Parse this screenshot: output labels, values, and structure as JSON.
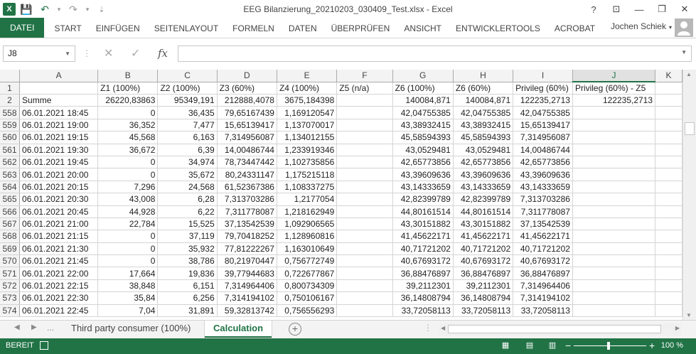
{
  "window": {
    "title": "EEG Bilanzierung_20210203_030409_Test.xlsx - Excel",
    "help": "?",
    "ribbon_display": "⊡",
    "minimize": "—",
    "restore": "❐",
    "close": "✕"
  },
  "qat": {
    "logo": "X",
    "save": "💾",
    "undo": "↶",
    "undo_caret": "▾",
    "redo": "↷",
    "redo_caret": "▾",
    "customize": "⇣"
  },
  "ribbon": {
    "tabs": [
      "DATEI",
      "START",
      "EINFÜGEN",
      "SEITENLAYOUT",
      "FORMELN",
      "DATEN",
      "ÜBERPRÜFEN",
      "ANSICHT",
      "ENTWICKLERTOOLS",
      "ACROBAT"
    ],
    "user": "Jochen Schiek"
  },
  "formula_bar": {
    "name_box": "J8",
    "cancel": "✕",
    "enter": "✓",
    "fx": "fx",
    "value": ""
  },
  "grid": {
    "columns": [
      "A",
      "B",
      "C",
      "D",
      "E",
      "F",
      "G",
      "H",
      "I",
      "J",
      "K"
    ],
    "selected_column": "J",
    "header_row": {
      "num": "1",
      "cells": [
        "",
        "Z1 (100%)",
        "Z2 (100%)",
        "Z3 (60%)",
        "Z4 (100%)",
        "Z5 (n/a)",
        "Z6 (100%)",
        "Z6 (60%)",
        "Privileg (60%)",
        "Privileg (60%) - Z5",
        ""
      ]
    },
    "sum_row": {
      "num": "2",
      "cells": [
        "Summe",
        "26220,83863",
        "95349,191",
        "212888,4078",
        "3675,184398",
        "",
        "140084,871",
        "140084,871",
        "122235,2713",
        "122235,2713",
        ""
      ]
    },
    "rows": [
      {
        "num": "558",
        "cells": [
          "06.01.2021 18:45",
          "0",
          "36,435",
          "79,65167439",
          "1,169120547",
          "",
          "42,04755385",
          "42,04755385",
          "42,04755385",
          "",
          ""
        ]
      },
      {
        "num": "559",
        "cells": [
          "06.01.2021 19:00",
          "36,352",
          "7,477",
          "15,65139417",
          "1,137070017",
          "",
          "43,38932415",
          "43,38932415",
          "15,65139417",
          "",
          ""
        ]
      },
      {
        "num": "560",
        "cells": [
          "06.01.2021 19:15",
          "45,568",
          "6,163",
          "7,314956087",
          "1,134012155",
          "",
          "45,58594393",
          "45,58594393",
          "7,314956087",
          "",
          ""
        ]
      },
      {
        "num": "561",
        "cells": [
          "06.01.2021 19:30",
          "36,672",
          "6,39",
          "14,00486744",
          "1,233919346",
          "",
          "43,0529481",
          "43,0529481",
          "14,00486744",
          "",
          ""
        ]
      },
      {
        "num": "562",
        "cells": [
          "06.01.2021 19:45",
          "0",
          "34,974",
          "78,73447442",
          "1,102735856",
          "",
          "42,65773856",
          "42,65773856",
          "42,65773856",
          "",
          ""
        ]
      },
      {
        "num": "563",
        "cells": [
          "06.01.2021 20:00",
          "0",
          "35,672",
          "80,24331147",
          "1,175215118",
          "",
          "43,39609636",
          "43,39609636",
          "43,39609636",
          "",
          ""
        ]
      },
      {
        "num": "564",
        "cells": [
          "06.01.2021 20:15",
          "7,296",
          "24,568",
          "61,52367386",
          "1,108337275",
          "",
          "43,14333659",
          "43,14333659",
          "43,14333659",
          "",
          ""
        ]
      },
      {
        "num": "565",
        "cells": [
          "06.01.2021 20:30",
          "43,008",
          "6,28",
          "7,313703286",
          "1,2177054",
          "",
          "42,82399789",
          "42,82399789",
          "7,313703286",
          "",
          ""
        ]
      },
      {
        "num": "566",
        "cells": [
          "06.01.2021 20:45",
          "44,928",
          "6,22",
          "7,311778087",
          "1,218162949",
          "",
          "44,80161514",
          "44,80161514",
          "7,311778087",
          "",
          ""
        ]
      },
      {
        "num": "567",
        "cells": [
          "06.01.2021 21:00",
          "22,784",
          "15,525",
          "37,13542539",
          "1,092906565",
          "",
          "43,30151882",
          "43,30151882",
          "37,13542539",
          "",
          ""
        ]
      },
      {
        "num": "568",
        "cells": [
          "06.01.2021 21:15",
          "0",
          "37,119",
          "79,70418252",
          "1,128960816",
          "",
          "41,45622171",
          "41,45622171",
          "41,45622171",
          "",
          ""
        ]
      },
      {
        "num": "569",
        "cells": [
          "06.01.2021 21:30",
          "0",
          "35,932",
          "77,81222267",
          "1,163010649",
          "",
          "40,71721202",
          "40,71721202",
          "40,71721202",
          "",
          ""
        ]
      },
      {
        "num": "570",
        "cells": [
          "06.01.2021 21:45",
          "0",
          "38,786",
          "80,21970447",
          "0,756772749",
          "",
          "40,67693172",
          "40,67693172",
          "40,67693172",
          "",
          ""
        ]
      },
      {
        "num": "571",
        "cells": [
          "06.01.2021 22:00",
          "17,664",
          "19,836",
          "39,77944683",
          "0,722677867",
          "",
          "36,88476897",
          "36,88476897",
          "36,88476897",
          "",
          ""
        ]
      },
      {
        "num": "572",
        "cells": [
          "06.01.2021 22:15",
          "38,848",
          "6,151",
          "7,314964406",
          "0,800734309",
          "",
          "39,2112301",
          "39,2112301",
          "7,314964406",
          "",
          ""
        ]
      },
      {
        "num": "573",
        "cells": [
          "06.01.2021 22:30",
          "35,84",
          "6,256",
          "7,314194102",
          "0,750106167",
          "",
          "36,14808794",
          "36,14808794",
          "7,314194102",
          "",
          ""
        ]
      },
      {
        "num": "574",
        "cells": [
          "06.01.2021 22:45",
          "7,04",
          "31,891",
          "59,32813742",
          "0,756556293",
          "",
          "33,72058113",
          "33,72058113",
          "33,72058113",
          "",
          ""
        ]
      }
    ]
  },
  "sheets": {
    "nav_prev": "◀",
    "nav_next": "▶",
    "more": "...",
    "tabs": [
      "Third party consumer (100%)",
      "Calculation"
    ],
    "active": "Calculation",
    "add": "+"
  },
  "status": {
    "mode": "BEREIT",
    "zoom_minus": "−",
    "zoom_plus": "+",
    "zoom": "100 %"
  },
  "colors": {
    "excel_green": "#217346",
    "header_bg": "#f3f3f3",
    "gridline": "#d4d4d4"
  }
}
